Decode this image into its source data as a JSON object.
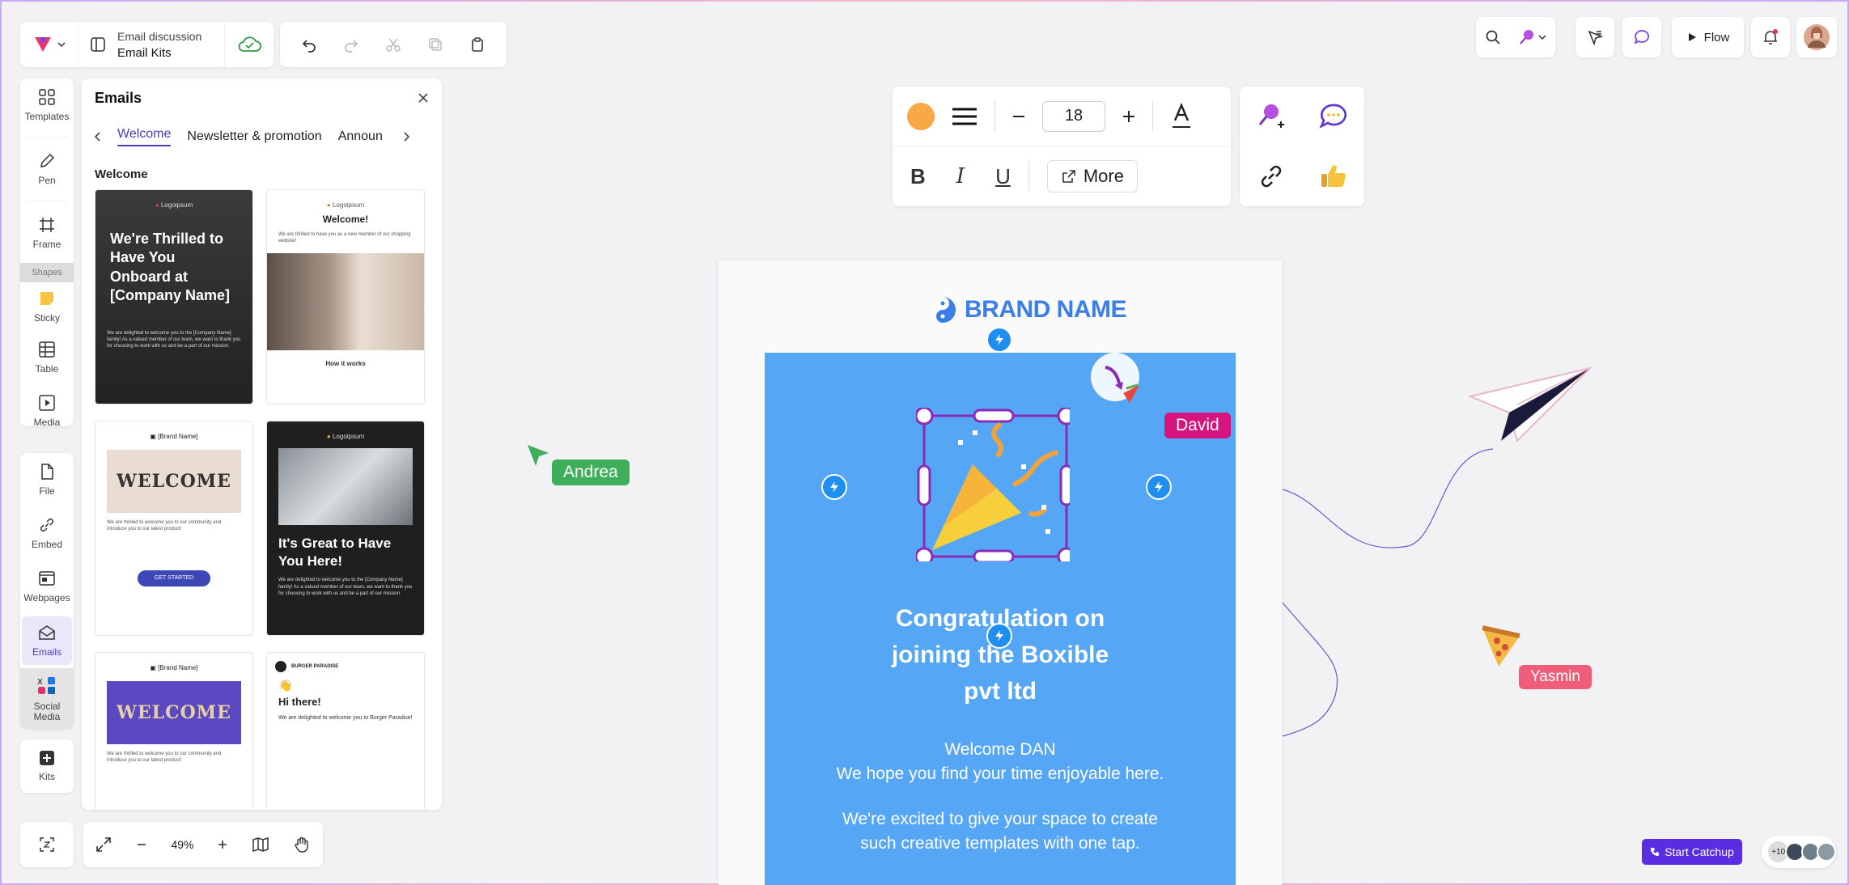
{
  "document": {
    "subtitle": "Email discussion",
    "title": "Email Kits"
  },
  "top_right": {
    "flow_label": "Flow"
  },
  "left_toolbar": {
    "templates": "Templates",
    "pen": "Pen",
    "frame": "Frame",
    "shapes": "Shapes",
    "sticky": "Sticky",
    "table": "Table",
    "media": "Media",
    "file": "File",
    "embed": "Embed",
    "webpages": "Webpages",
    "emails": "Emails",
    "social_media": "Social Media",
    "kits": "Kits"
  },
  "emails_panel": {
    "title": "Emails",
    "tabs": [
      "Welcome",
      "Newsletter & promotion",
      "Announ"
    ],
    "section": "Welcome",
    "templates": [
      {
        "logo": "Logoipsum",
        "heading": "We're Thrilled to Have You Onboard at [Company Name]",
        "body": "We are delighted to welcome you to the [Company Name] family! As a valued member of our team, we want to thank you for choosing to work with us and be a part of our mission."
      },
      {
        "logo": "Logoipsum",
        "heading": "Welcome!",
        "body": "We are thrilled to have you as a new member of our shopping website!",
        "footer": "How it works"
      },
      {
        "logo": "[Brand Name]",
        "heading": "WELCOME",
        "body": "We are thrilled to welcome you to our community and introduce you to our latest product!",
        "button": "GET STARTED"
      },
      {
        "logo": "Logoipsum",
        "heading": "It's Great to Have You Here!",
        "body": "We are delighted to welcome you to the [Company Name] family! As a valued member of our team, we want to thank you for choosing to work with us and be a part of our mission."
      },
      {
        "logo": "[Brand Name]",
        "heading": "WELCOME",
        "body": "We are thrilled to welcome you to our community and introduce you to our latest product!"
      },
      {
        "logo": "BURGER PARADISE",
        "heading": "Hi there!",
        "body": "We are delighted to welcome you to Burger Paradise!"
      }
    ]
  },
  "zoom": {
    "value": "49%"
  },
  "format_toolbar": {
    "font_size": "18",
    "bold": "B",
    "italic": "I",
    "underline": "U",
    "more": "More"
  },
  "email": {
    "brand": "BRAND NAME",
    "headline": [
      "Congratulation on",
      "joining the Boxible",
      "pvt ltd"
    ],
    "welcome": [
      "Welcome DAN",
      "We hope you find your time enjoyable here."
    ],
    "excited": [
      "We're excited to give your space to create",
      "such creative templates with one tap."
    ],
    "background_color": "#55a6f5"
  },
  "collaborators": {
    "andrea": {
      "name": "Andrea",
      "color": "#3fae5a"
    },
    "david": {
      "name": "David",
      "color": "#d6147f"
    },
    "yasmin": {
      "name": "Yasmin",
      "color": "#ef5d7a"
    },
    "count": "+10"
  },
  "catchup": {
    "label": "Start Catchup"
  }
}
